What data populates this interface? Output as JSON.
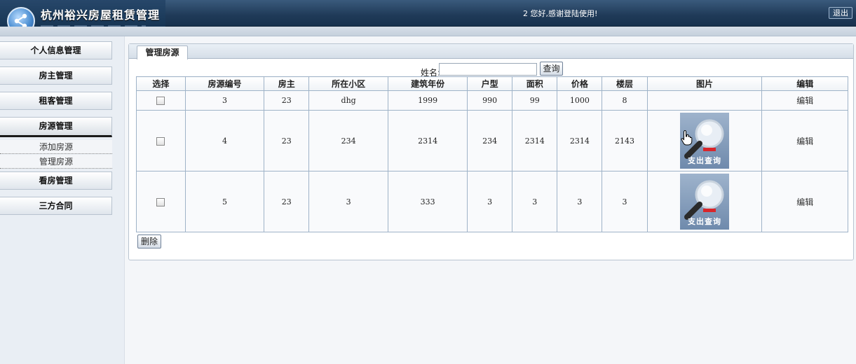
{
  "header": {
    "title": "杭州裕兴房屋租赁管理",
    "welcome": "2 您好,感谢登陆使用!",
    "logout_label": "退出"
  },
  "sidebar": {
    "items": [
      {
        "label": "个人信息管理"
      },
      {
        "label": "房主管理"
      },
      {
        "label": "租客管理"
      },
      {
        "label": "房源管理"
      },
      {
        "label": "看房管理"
      },
      {
        "label": "三方合同"
      }
    ],
    "submenu": [
      {
        "label": "添加房源"
      },
      {
        "label": "管理房源"
      }
    ]
  },
  "panel": {
    "tab_label": "管理房源",
    "search_label": "姓名:",
    "search_value": "",
    "search_button": "查询",
    "delete_button": "删除"
  },
  "table": {
    "headers": [
      "选择",
      "房源编号",
      "房主",
      "所在小区",
      "建筑年份",
      "户型",
      "面积",
      "价格",
      "楼层",
      "图片",
      "编辑"
    ],
    "rows": [
      {
        "id": "3",
        "owner": "23",
        "community": "dhg",
        "year": "1999",
        "type": "990",
        "area": "99",
        "price": "1000",
        "floor": "8",
        "has_image": false,
        "edit": "编辑"
      },
      {
        "id": "4",
        "owner": "23",
        "community": "234",
        "year": "2314",
        "type": "234",
        "area": "2314",
        "price": "2314",
        "floor": "2143",
        "has_image": true,
        "image_caption": "支出查询",
        "edit": "编辑"
      },
      {
        "id": "5",
        "owner": "23",
        "community": "3",
        "year": "333",
        "type": "3",
        "area": "3",
        "price": "3",
        "floor": "3",
        "has_image": true,
        "image_caption": "支出查询",
        "edit": "编辑"
      }
    ]
  },
  "icons": {
    "logo": "share-nodes-icon",
    "thumbnail": "magnifier-icon",
    "cursor": "hand-pointer-icon"
  }
}
